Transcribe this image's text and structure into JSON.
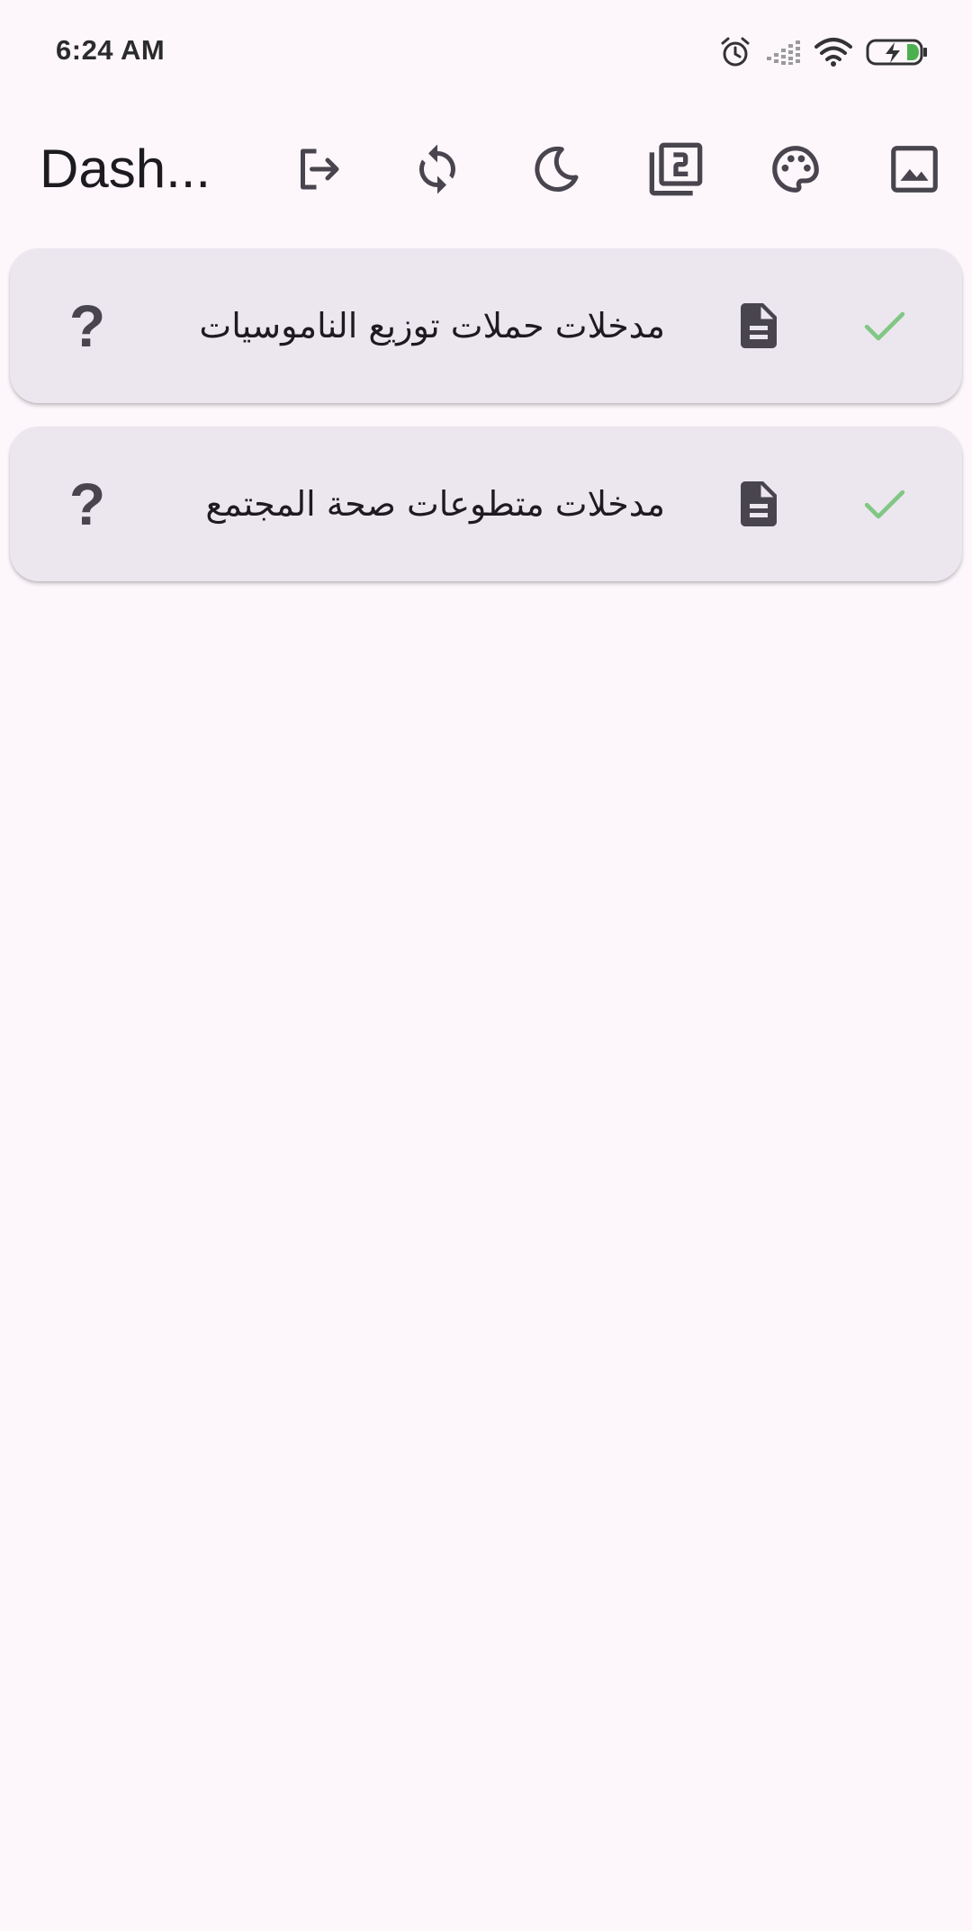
{
  "status_bar": {
    "time": "6:24 AM",
    "icons": [
      "alarm-icon",
      "signal-icon",
      "wifi-icon",
      "battery-charging-icon"
    ]
  },
  "app_bar": {
    "title": "Dash...",
    "actions": [
      {
        "name": "logout-icon",
        "label": "Logout"
      },
      {
        "name": "sync-icon",
        "label": "Sync"
      },
      {
        "name": "dark-mode-icon",
        "label": "Dark mode"
      },
      {
        "name": "filter-2-icon",
        "label": "Filter"
      },
      {
        "name": "palette-icon",
        "label": "Palette"
      },
      {
        "name": "image-icon",
        "label": "Image"
      }
    ]
  },
  "cards": [
    {
      "label": "مدخلات حملات توزيع الناموسيات",
      "leading_icon": "check-icon",
      "doc_icon": "description-icon",
      "trailing_icon": "help-icon",
      "help_text": "?"
    },
    {
      "label": "مدخلات متطوعات صحة المجتمع",
      "leading_icon": "check-icon",
      "doc_icon": "description-icon",
      "trailing_icon": "help-icon",
      "help_text": "?"
    }
  ],
  "colors": {
    "background": "#fdf7fc",
    "card": "#ece6ef",
    "icon": "#49454f",
    "check": "#81c784",
    "battery_charge": "#4caf50"
  }
}
